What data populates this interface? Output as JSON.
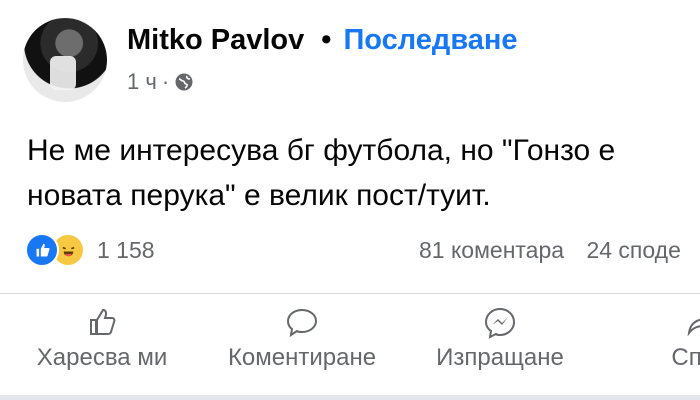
{
  "author": {
    "name": "Mitko Pavlov",
    "follow_label": "Последване",
    "separator": "•"
  },
  "timestamp": "1 ч",
  "time_separator": "·",
  "post_text": "Не ме интересува бг футбола, но \"Гонзо е новата перука\" е велик пост/туит.",
  "stats": {
    "reactions_count": "1 158",
    "comments": "81 коментара",
    "shares": "24 споде"
  },
  "actions": [
    {
      "label": "Харесва ми"
    },
    {
      "label": "Коментиране"
    },
    {
      "label": "Изпращане"
    },
    {
      "label": "Спод"
    }
  ],
  "colors": {
    "accent": "#1877f2",
    "text": "#050505",
    "muted": "#65676b",
    "like": "#1877f2",
    "haha": "#f7c943"
  },
  "icons": [
    "globe-icon",
    "like-reaction-icon",
    "haha-reaction-icon",
    "thumbs-up-icon",
    "comment-icon",
    "messenger-icon",
    "share-icon"
  ]
}
